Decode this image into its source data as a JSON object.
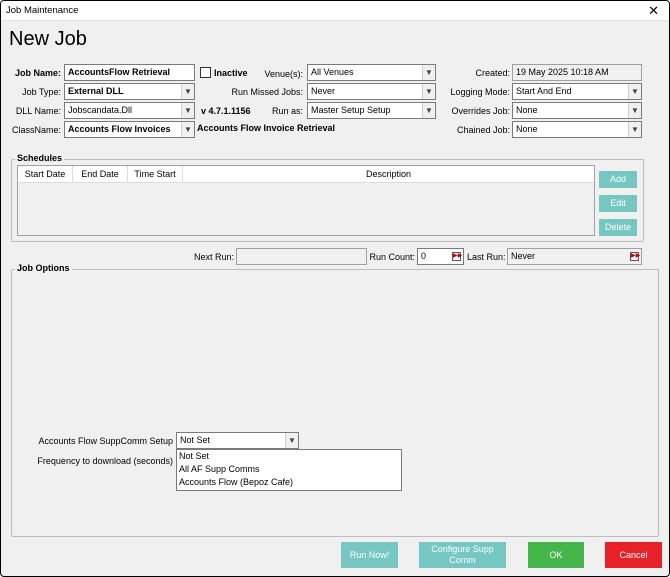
{
  "window": {
    "title": "Job Maintenance",
    "close_glyph": "✕"
  },
  "page_title": "New Job",
  "form": {
    "job_name": {
      "label": "Job Name:",
      "value": "AccountsFlow Retrieval"
    },
    "inactive": {
      "label": "Inactive",
      "checked": false
    },
    "venues": {
      "label": "Venue(s):",
      "value": "All Venues"
    },
    "created": {
      "label": "Created:",
      "value": "19 May 2025 10:18 AM"
    },
    "job_type": {
      "label": "Job Type:",
      "value": "External DLL"
    },
    "run_missed_jobs": {
      "label": "Run Missed Jobs:",
      "value": "Never"
    },
    "logging_mode": {
      "label": "Logging Mode:",
      "value": "Start And End"
    },
    "dll_name": {
      "label": "DLL Name:",
      "value": "Jobscandata.Dll"
    },
    "version": "v 4.7.1.1156",
    "run_as": {
      "label": "Run as:",
      "value": "Master Setup  Setup"
    },
    "overrides_job": {
      "label": "Overrides Job:",
      "value": "None"
    },
    "class_name": {
      "label": "ClassName:",
      "value": "Accounts Flow Invoices"
    },
    "class_description": "Accounts Flow Invoice Retrieval",
    "chained_job": {
      "label": "Chained Job:",
      "value": "None"
    }
  },
  "schedules": {
    "title": "Schedules",
    "columns": [
      "Start Date",
      "End Date",
      "Time Start",
      "Description"
    ],
    "rows": [],
    "buttons": {
      "add": "Add",
      "edit": "Edit",
      "delete": "Delete"
    }
  },
  "run_info": {
    "next_run": {
      "label": "Next Run:",
      "value": ""
    },
    "run_count": {
      "label": "Run Count:",
      "value": "0"
    },
    "last_run": {
      "label": "Last Run:",
      "value": "Never"
    }
  },
  "job_options": {
    "title": "Job Options",
    "suppcomm_setup": {
      "label": "Accounts Flow SuppComm Setup",
      "value": "Not Set",
      "options": [
        "Not Set",
        "All AF Supp Comms",
        "Accounts Flow (Bepoz Cafe)"
      ]
    },
    "frequency": {
      "label": "Frequency to download (seconds)"
    }
  },
  "footer": {
    "run_now": "Run Now!",
    "configure": "Configure Supp Comm",
    "ok": "OK",
    "cancel": "Cancel"
  },
  "colors": {
    "teal_button": "#76c6c2",
    "ok_button": "#45b649",
    "cancel_button": "#e8202a",
    "window_bg": "#f0f0f0"
  },
  "icons": {
    "dropdown": "chevron-down-icon",
    "spin": "double-arrow-right-icon",
    "close": "close-icon"
  }
}
